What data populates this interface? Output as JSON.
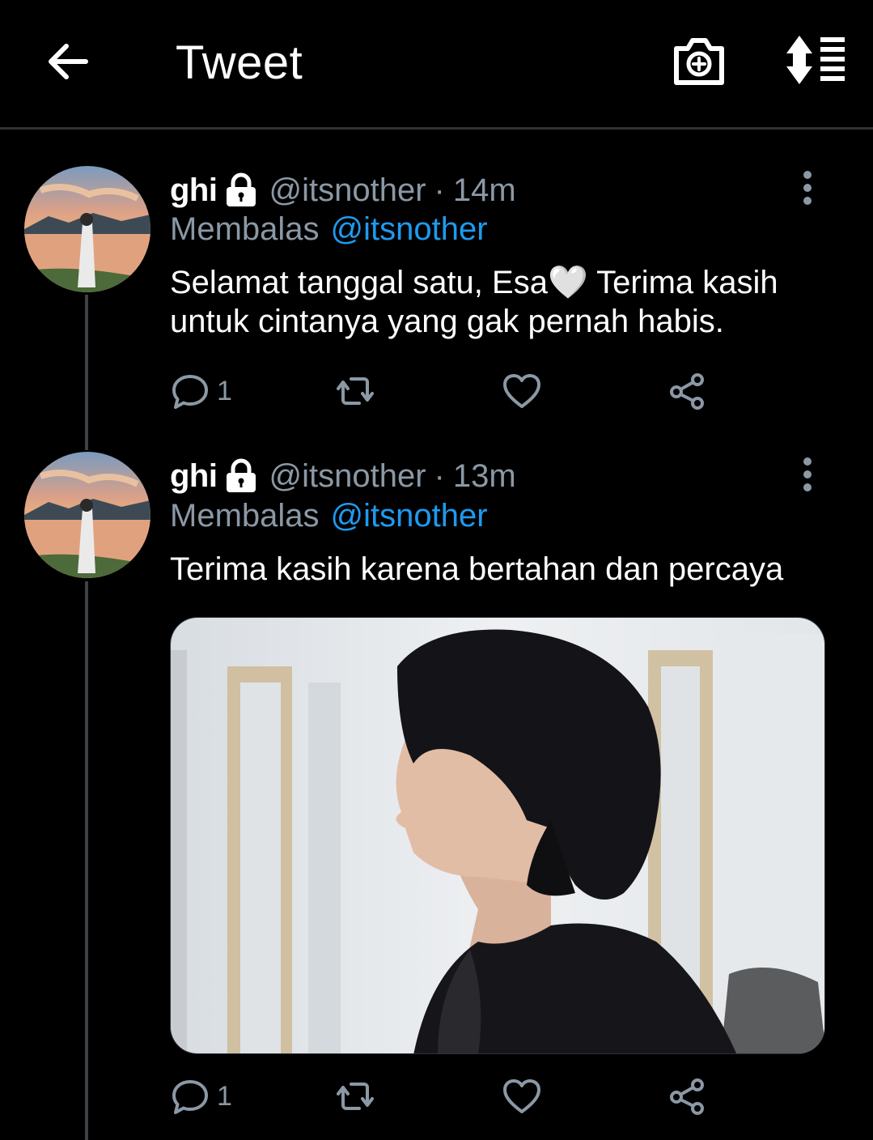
{
  "header": {
    "title": "Tweet",
    "back_icon": "arrow-left-icon",
    "camera_icon": "camera-plus-icon",
    "sort_icon": "sort-list-icon"
  },
  "colors": {
    "background": "#000000",
    "secondary_text": "#8b98a5",
    "link": "#1d9bf0",
    "thread_line": "#3d4247"
  },
  "tweets": [
    {
      "name": "ghi",
      "handle": "@itsnother",
      "separator": "·",
      "time": "14m",
      "reply_label": "Membalas",
      "reply_to": "@itsnother",
      "text": "Selamat tanggal satu, Esa🤍 Terima kasih untuk cintanya yang gak pernah habis.",
      "reply_count": "1",
      "icons": [
        "lock-icon",
        "more-vertical-icon",
        "reply-icon",
        "retweet-icon",
        "like-icon",
        "share-icon"
      ]
    },
    {
      "name": "ghi",
      "handle": "@itsnother",
      "separator": "·",
      "time": "13m",
      "reply_label": "Membalas",
      "reply_to": "@itsnother",
      "text": "Terima kasih karena bertahan dan percaya",
      "reply_count": "1",
      "has_media": true,
      "icons": [
        "lock-icon",
        "more-vertical-icon",
        "reply-icon",
        "retweet-icon",
        "like-icon",
        "share-icon"
      ]
    }
  ]
}
